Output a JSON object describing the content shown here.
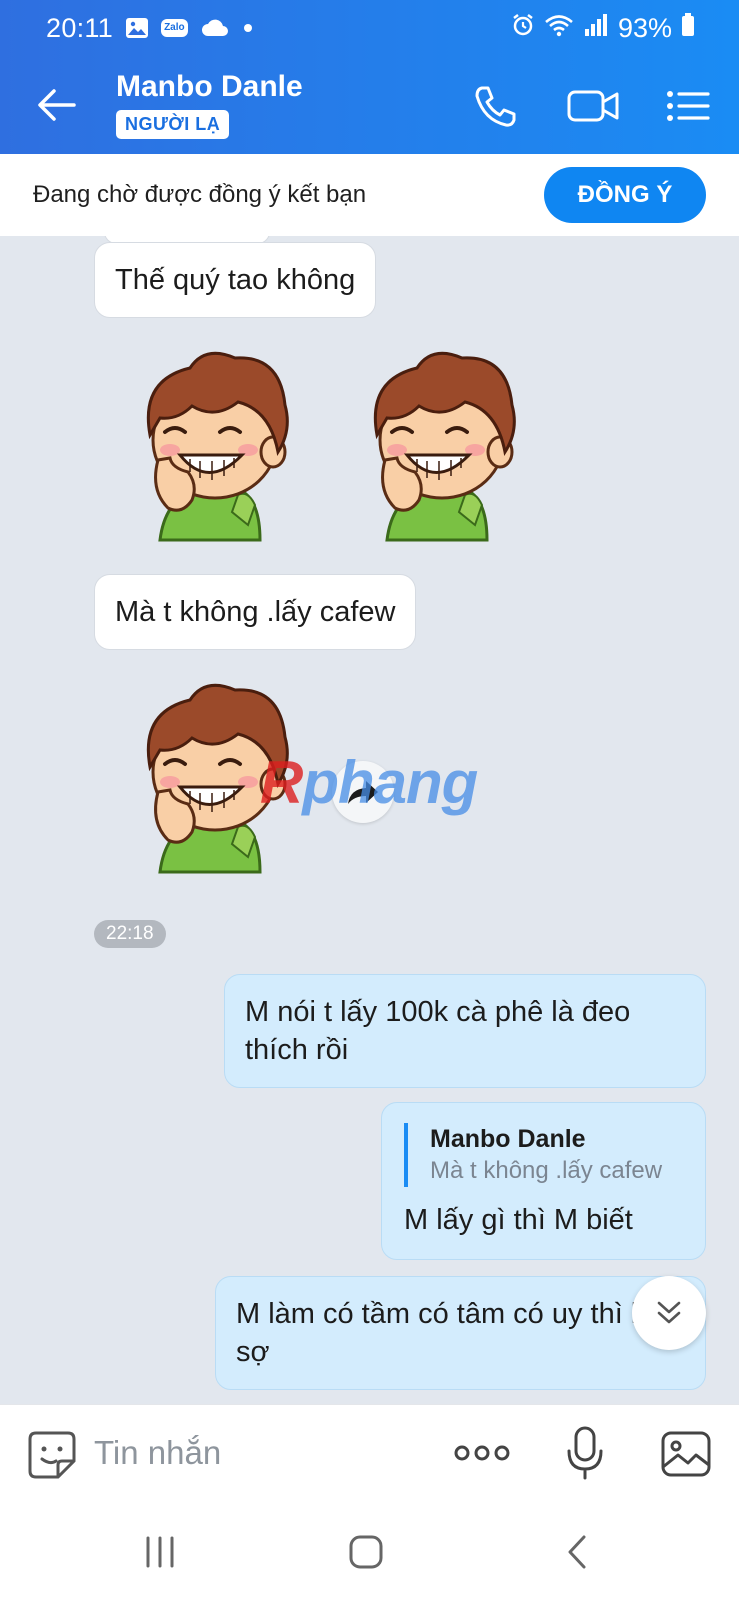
{
  "status_bar": {
    "time": "20:11",
    "zalo_label": "Zalo",
    "battery": "93%"
  },
  "header": {
    "contact_name": "Manbo Danle",
    "badge": "NGƯỜI LẠ"
  },
  "friend_request": {
    "message": "Đang chờ được đồng ý kết bạn",
    "accept_label": "ĐỒNG Ý"
  },
  "chat": {
    "messages_in": [
      {
        "text": "Thế quý tao không"
      },
      {
        "text": "Mà t không .lấy cafew"
      }
    ],
    "time_badge": "22:18",
    "watermark": {
      "first": "R",
      "rest": "phang"
    },
    "messages_out": [
      {
        "text": "M nói t lấy 100k cà phê là đeo thích rồi"
      },
      {
        "quote_name": "Manbo Danle",
        "quote_text": "Mà t không .lấy cafew",
        "text": "M lấy gì thì M biết"
      },
      {
        "text": "M làm có tầm có tâm có uy thì kg sợ"
      }
    ]
  },
  "input_bar": {
    "placeholder": "Tin nhắn"
  },
  "icons": {
    "status": [
      "gallery-icon",
      "zalo-icon",
      "cloud-icon",
      "alarm-icon",
      "wifi-icon",
      "signal-icon",
      "battery-icon"
    ],
    "header": [
      "back-arrow-icon",
      "phone-icon",
      "video-camera-icon",
      "menu-list-icon"
    ],
    "input": [
      "sticker-emoji-icon",
      "more-dots-icon",
      "microphone-icon",
      "image-icon"
    ],
    "nav": [
      "recent-apps-icon",
      "home-icon",
      "back-icon"
    ]
  },
  "colors": {
    "header_gradient_start": "#2f6fe0",
    "header_gradient_end": "#1a8cf4",
    "accept_button": "#0f86f2",
    "chat_background": "#e2e7ee",
    "outgoing_bubble": "#d3ecfd",
    "incoming_bubble": "#ffffff"
  }
}
